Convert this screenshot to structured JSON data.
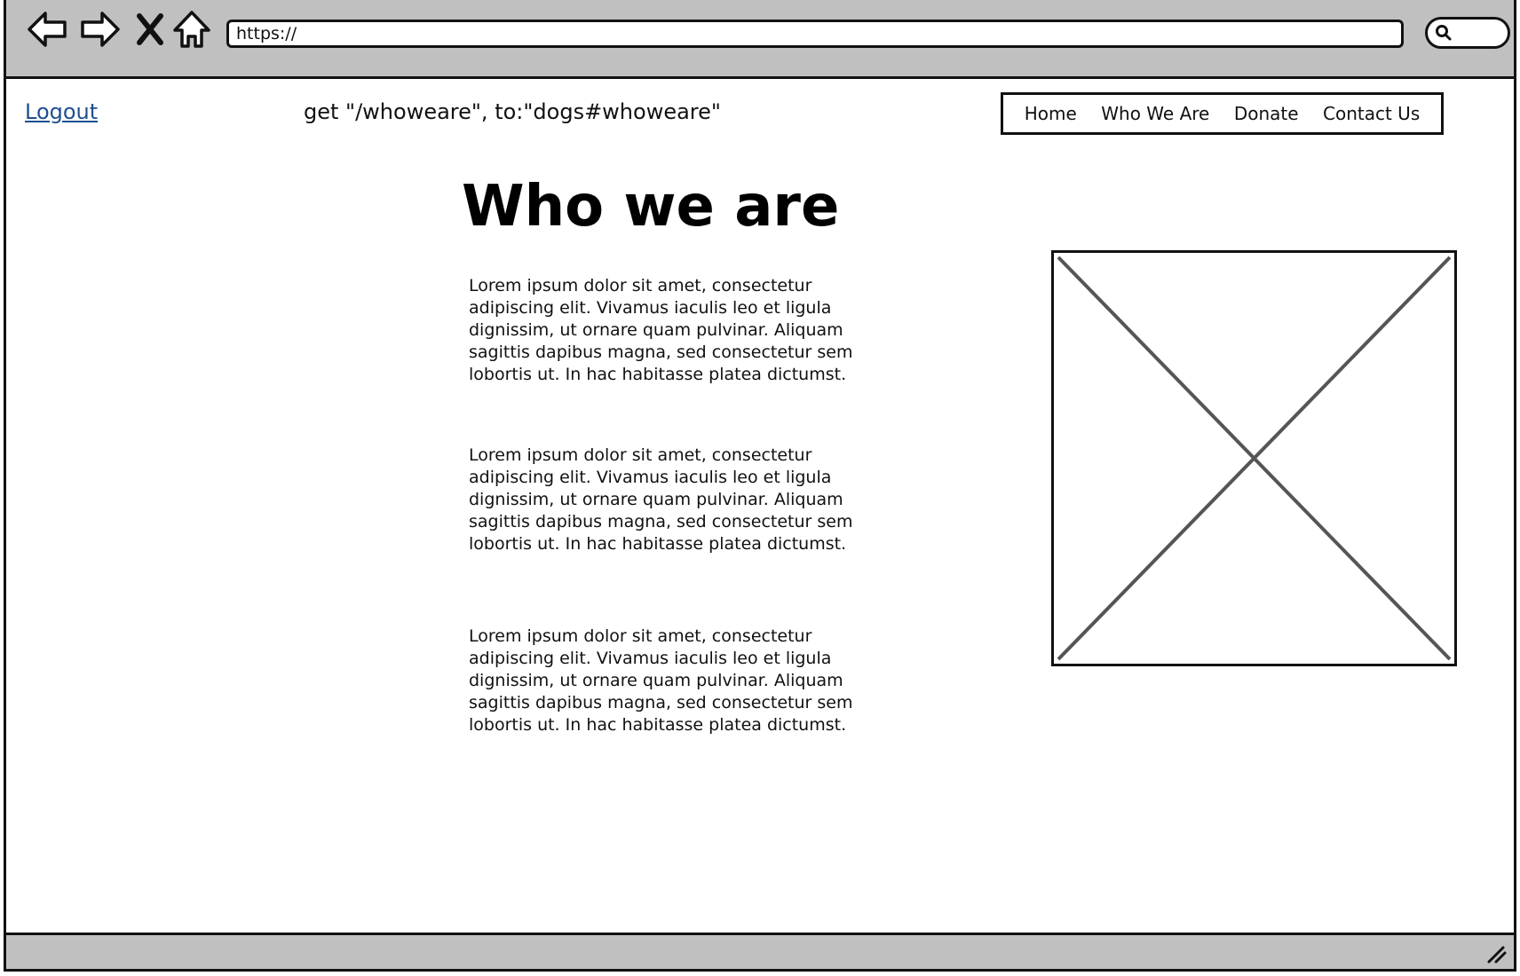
{
  "browser": {
    "url": "https://"
  },
  "header": {
    "logout_label": "Logout",
    "route_text": "get \"/whoweare\", to:\"dogs#whoweare\"",
    "nav": [
      "Home",
      "Who We Are",
      "Donate",
      "Contact Us"
    ]
  },
  "main": {
    "title": "Who we are",
    "paragraphs": [
      "Lorem ipsum dolor sit amet, consectetur adipiscing elit. Vivamus iaculis leo et ligula dignissim, ut ornare quam pulvinar. Aliquam sagittis dapibus magna, sed consectetur sem lobortis ut. In hac habitasse platea dictumst.",
      "Lorem ipsum dolor sit amet, consectetur adipiscing elit. Vivamus iaculis leo et ligula dignissim, ut ornare quam pulvinar. Aliquam sagittis dapibus magna, sed consectetur sem lobortis ut. In hac habitasse platea dictumst.",
      "Lorem ipsum dolor sit amet, consectetur adipiscing elit. Vivamus iaculis leo et ligula dignissim, ut ornare quam pulvinar. Aliquam sagittis dapibus magna, sed consectetur sem lobortis ut. In hac habitasse platea dictumst."
    ]
  },
  "icons": {
    "back": "back-arrow-icon",
    "forward": "forward-arrow-icon",
    "stop": "close-icon",
    "home": "home-icon",
    "search": "search-icon",
    "resize": "resize-grip-icon",
    "image": "image-placeholder-icon"
  },
  "colors": {
    "chrome": "#c0c0c0",
    "link": "#1f4f8f",
    "placeholder_cross": "#555555"
  }
}
